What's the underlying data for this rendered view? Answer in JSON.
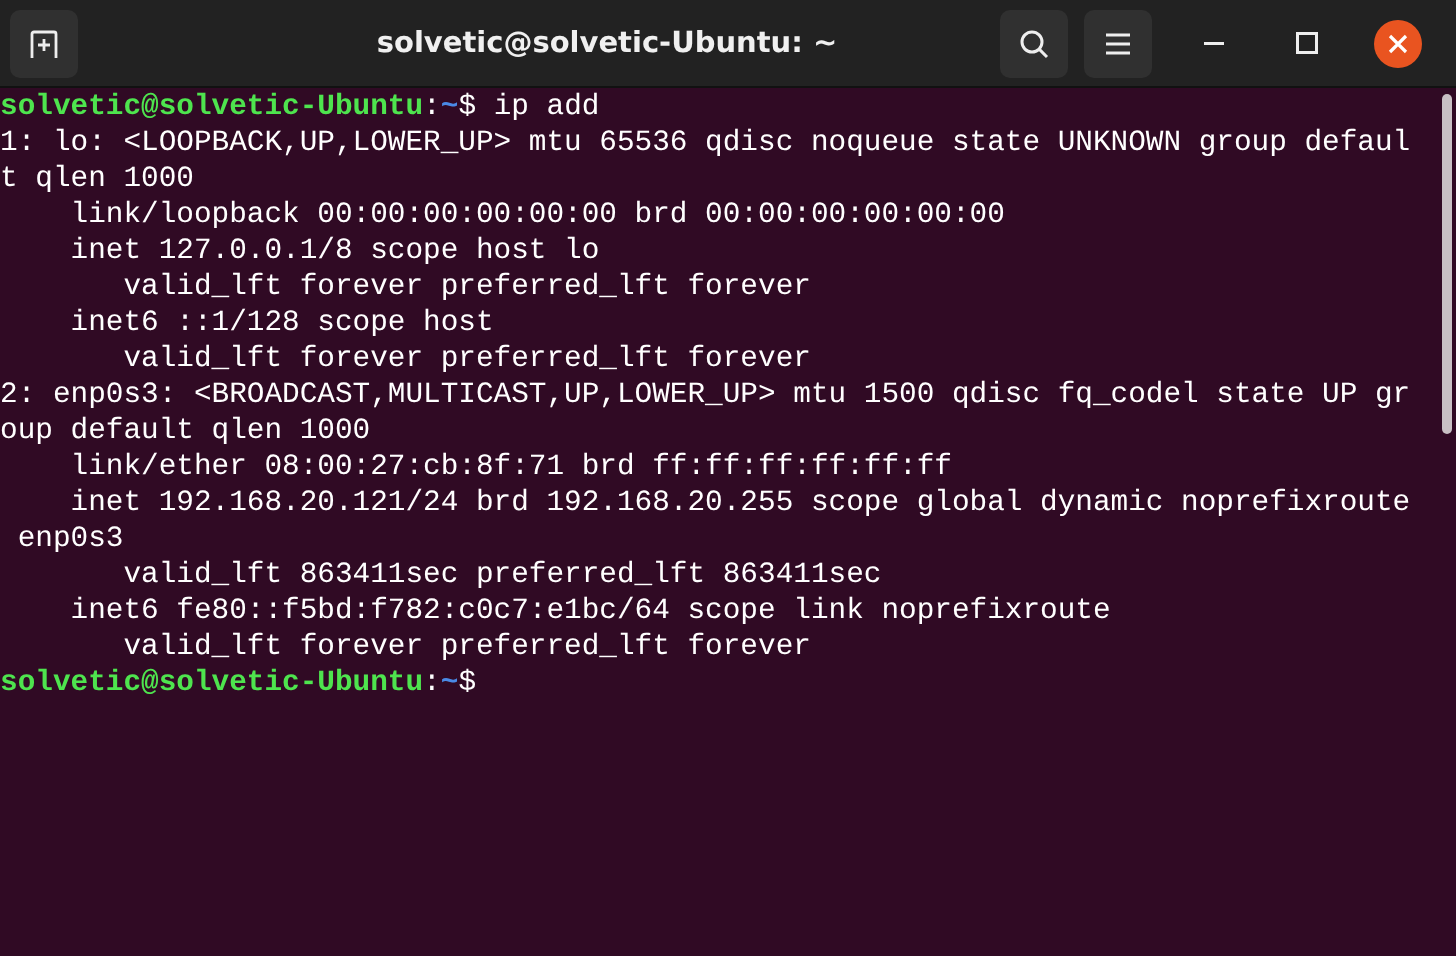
{
  "window": {
    "title": "solvetic@solvetic-Ubuntu: ~"
  },
  "terminal": {
    "lines": [
      {
        "kind": "prompt",
        "user": "solvetic@solvetic-Ubuntu",
        "separator": ":",
        "path": "~",
        "symbol": "$",
        "command": " ip add"
      },
      {
        "kind": "output",
        "text": "1: lo: <LOOPBACK,UP,LOWER_UP> mtu 65536 qdisc noqueue state UNKNOWN group defaul"
      },
      {
        "kind": "output",
        "text": "t qlen 1000"
      },
      {
        "kind": "output",
        "text": "    link/loopback 00:00:00:00:00:00 brd 00:00:00:00:00:00"
      },
      {
        "kind": "output",
        "text": "    inet 127.0.0.1/8 scope host lo"
      },
      {
        "kind": "output",
        "text": "       valid_lft forever preferred_lft forever"
      },
      {
        "kind": "output",
        "text": "    inet6 ::1/128 scope host"
      },
      {
        "kind": "output",
        "text": "       valid_lft forever preferred_lft forever"
      },
      {
        "kind": "output",
        "text": "2: enp0s3: <BROADCAST,MULTICAST,UP,LOWER_UP> mtu 1500 qdisc fq_codel state UP gr"
      },
      {
        "kind": "output",
        "text": "oup default qlen 1000"
      },
      {
        "kind": "output",
        "text": "    link/ether 08:00:27:cb:8f:71 brd ff:ff:ff:ff:ff:ff"
      },
      {
        "kind": "output",
        "text": "    inet 192.168.20.121/24 brd 192.168.20.255 scope global dynamic noprefixroute"
      },
      {
        "kind": "output",
        "text": " enp0s3"
      },
      {
        "kind": "output",
        "text": "       valid_lft 863411sec preferred_lft 863411sec"
      },
      {
        "kind": "output",
        "text": "    inet6 fe80::f5bd:f782:c0c7:e1bc/64 scope link noprefixroute"
      },
      {
        "kind": "output",
        "text": "       valid_lft forever preferred_lft forever"
      },
      {
        "kind": "prompt",
        "user": "solvetic@solvetic-Ubuntu",
        "separator": ":",
        "path": "~",
        "symbol": "$"
      }
    ]
  }
}
